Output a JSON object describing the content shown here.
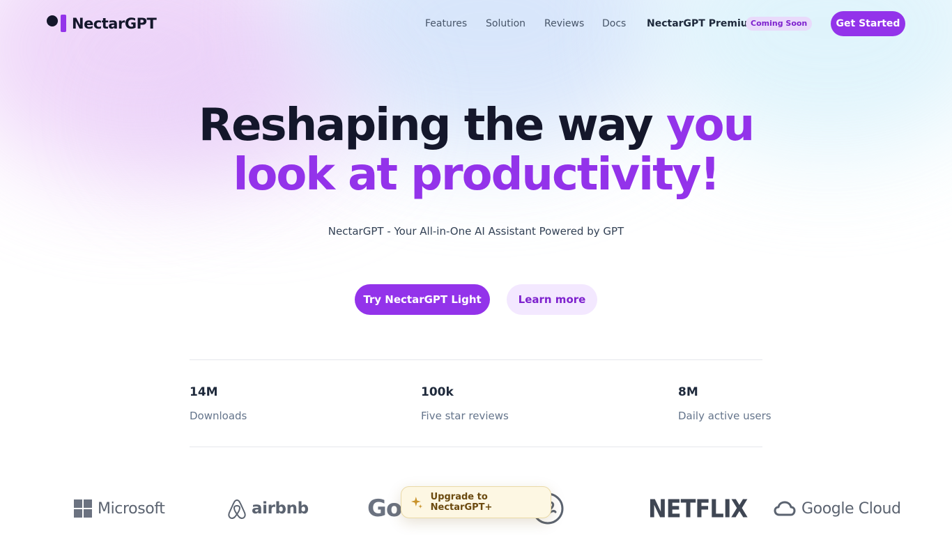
{
  "brand": {
    "name": "NectarGPT",
    "accent_color": "#9333ea",
    "dark_color": "#14172b"
  },
  "nav": {
    "items": [
      "Features",
      "Solution",
      "Reviews",
      "Docs"
    ],
    "premium_label": "NectarGPT Premium",
    "premium_badge": "Coming Soon",
    "cta_label": "Get Started"
  },
  "hero": {
    "title_dark": "Reshaping the way ",
    "title_accent_1": "you",
    "title_accent_2": "look at productivity!",
    "subtitle": "NectarGPT - Your All-in-One AI Assistant Powered by GPT",
    "primary_button": "Try NectarGPT Light",
    "secondary_button": "Learn more"
  },
  "stats": [
    {
      "value": "14M",
      "label": "Downloads"
    },
    {
      "value": "100k",
      "label": "Five star reviews"
    },
    {
      "value": "8M",
      "label": "Daily active users"
    }
  ],
  "logos": {
    "microsoft": "Microsoft",
    "airbnb": "airbnb",
    "google": "Go",
    "netflix": "NETFLIX",
    "google_cloud": "Google Cloud"
  },
  "upgrade": {
    "label": "Upgrade to NectarGPT+",
    "icon": "sparkle-icon"
  }
}
